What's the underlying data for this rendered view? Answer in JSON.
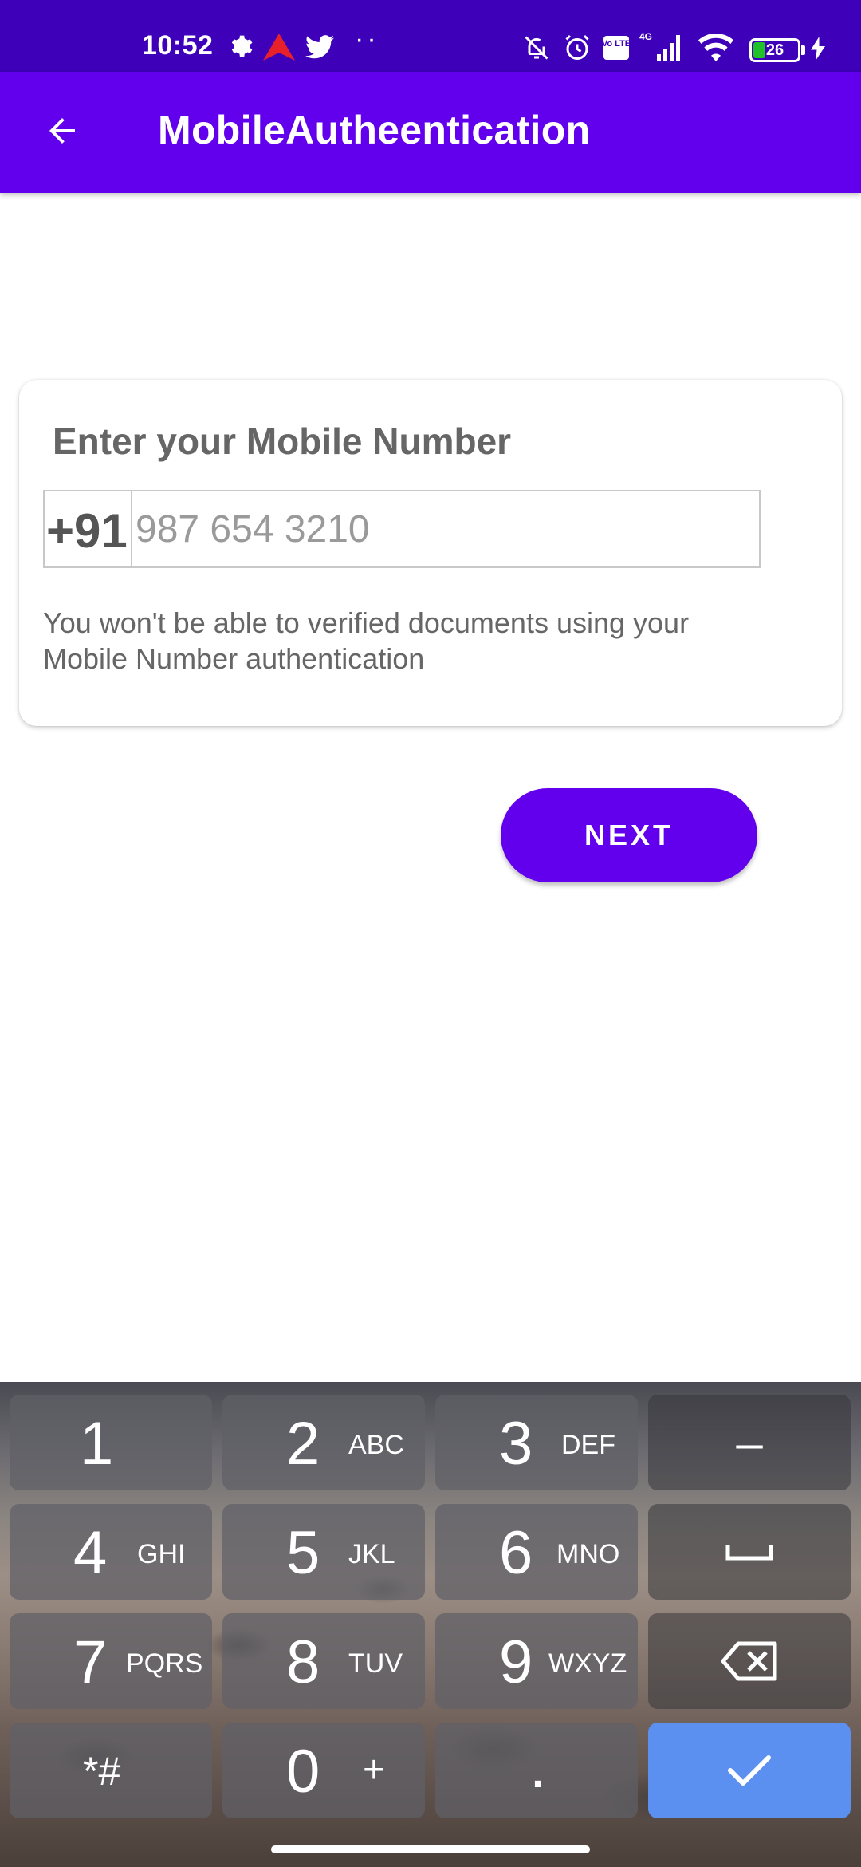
{
  "status_bar": {
    "time": "10:52",
    "battery": "26",
    "network_label": "4G",
    "volte_label": "Vo LTE",
    "icons": [
      "settings-icon",
      "red-arrow-app-icon",
      "twitter-icon",
      "more-dots-icon",
      "mute-icon",
      "alarm-icon",
      "volte-icon",
      "signal-icon",
      "wifi-icon",
      "battery-icon",
      "charging-icon"
    ],
    "more_dots": "··"
  },
  "app_bar": {
    "title": "MobileAutheentication",
    "back_icon": "arrow-left-icon",
    "color": "#6200ee"
  },
  "card": {
    "title": "Enter your Mobile Number",
    "prefix": "+91",
    "phone_placeholder": "987 654 3210",
    "phone_value": "",
    "note": "You won't be able to verified documents using your Mobile Number authentication"
  },
  "next_button": {
    "label": "NEXT"
  },
  "keyboard": {
    "keys": [
      {
        "digit": "1",
        "letters": ""
      },
      {
        "digit": "2",
        "letters": "ABC"
      },
      {
        "digit": "3",
        "letters": "DEF"
      },
      {
        "digit": "4",
        "letters": "GHI"
      },
      {
        "digit": "5",
        "letters": "JKL"
      },
      {
        "digit": "6",
        "letters": "MNO"
      },
      {
        "digit": "7",
        "letters": "PQRS"
      },
      {
        "digit": "8",
        "letters": "TUV"
      },
      {
        "digit": "9",
        "letters": "WXYZ"
      },
      {
        "digit": "*#",
        "letters": ""
      },
      {
        "digit": "0",
        "letters": "+"
      },
      {
        "digit": ".",
        "letters": ""
      }
    ],
    "minus": "–",
    "space_icon": "space-icon",
    "backspace_icon": "backspace-icon",
    "confirm_icon": "check-icon",
    "confirm_color": "#5b8ff0"
  }
}
